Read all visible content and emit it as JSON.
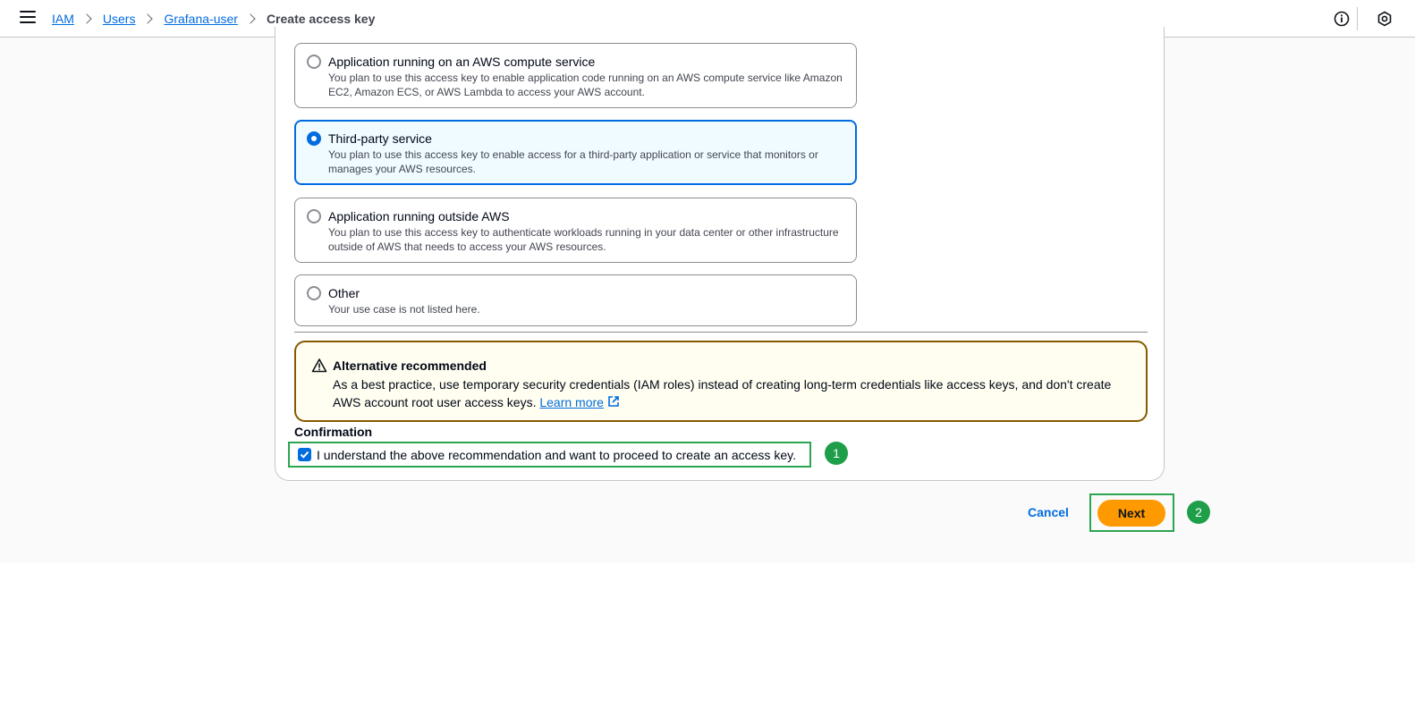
{
  "breadcrumb": {
    "items": [
      "IAM",
      "Users",
      "Grafana-user"
    ],
    "current": "Create access key"
  },
  "header": {
    "icons": [
      "info-icon",
      "settings-hexagon-icon"
    ]
  },
  "options": [
    {
      "title": "Application running on an AWS compute service",
      "description": "You plan to use this access key to enable application code running on an AWS compute service like Amazon EC2, Amazon ECS, or AWS Lambda to access your AWS account.",
      "selected": false
    },
    {
      "title": "Third-party service",
      "description": "You plan to use this access key to enable access for a third-party application or service that monitors or manages your AWS resources.",
      "selected": true
    },
    {
      "title": "Application running outside AWS",
      "description": "You plan to use this access key to authenticate workloads running in your data center or other infrastructure outside of AWS that needs to access your AWS resources.",
      "selected": false
    },
    {
      "title": "Other",
      "description": "Your use case is not listed here.",
      "selected": false
    }
  ],
  "alert": {
    "title": "Alternative recommended",
    "body": "As a best practice, use temporary security credentials (IAM roles) instead of creating long-term credentials like access keys, and don't create AWS account root user access keys.",
    "link": "Learn more",
    "icon": "warning-icon"
  },
  "confirmation": {
    "title": "Confirmation",
    "label": "I understand the above recommendation and want to proceed to create an access key.",
    "checked": true
  },
  "steps": [
    "1",
    "2"
  ],
  "actions": {
    "cancel": "Cancel",
    "next": "Next"
  },
  "colors": {
    "link": "#006ce0",
    "primary_button": "#ff9900",
    "alert_border": "#855900",
    "alert_bg": "#fffef0",
    "annotation": "#2ba54f"
  }
}
